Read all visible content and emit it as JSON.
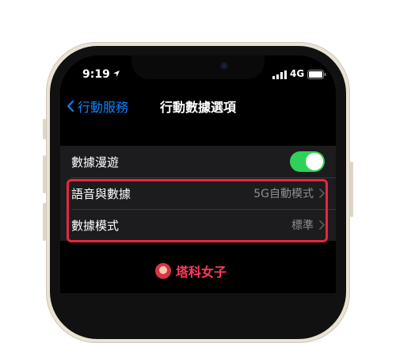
{
  "status_bar": {
    "time": "9:19",
    "network": "4G"
  },
  "nav": {
    "back_label": "行動服務",
    "title": "行動數據選項"
  },
  "settings": {
    "roaming": {
      "label": "數據漫遊",
      "on": true
    },
    "voice_data": {
      "label": "語音與數據",
      "value": "5G自動模式"
    },
    "data_mode": {
      "label": "數據模式",
      "value": "標準"
    }
  },
  "watermark": {
    "text": "塔科女子"
  },
  "colors": {
    "accent": "#0a84ff",
    "toggle_on": "#30d158",
    "highlight": "#e8263d"
  }
}
